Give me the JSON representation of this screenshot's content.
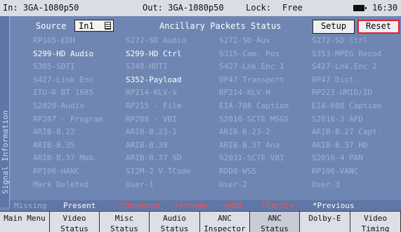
{
  "status_bar": {
    "input": "In: 3GA-1080p50",
    "output": "Out: 3GA-1080p50",
    "lock_label": "Lock:",
    "lock_value": "Free",
    "time": "16:30"
  },
  "side_tab": "Signal Information",
  "header": {
    "source_label": "Source",
    "source_value": "In1",
    "title": "Ancillary Packets Status",
    "setup_label": "Setup",
    "reset_label": "Reset"
  },
  "packets": [
    [
      {
        "t": "RP165-EDH",
        "hi": false
      },
      {
        "t": "S272-SD Audio",
        "hi": false
      },
      {
        "t": "S272-SD Aux",
        "hi": false
      },
      {
        "t": "S272-SD Ctrl",
        "hi": false
      }
    ],
    [
      {
        "t": "S299-HD Audio",
        "hi": true
      },
      {
        "t": "S299-HD Ctrl",
        "hi": true
      },
      {
        "t": "S315-Cam. Pos",
        "hi": false
      },
      {
        "t": "S353-MPEG Recod",
        "hi": false
      }
    ],
    [
      {
        "t": "S305-SDTI",
        "hi": false
      },
      {
        "t": "S348-HDTI",
        "hi": false
      },
      {
        "t": "S427-Lnk.Enc 1",
        "hi": false
      },
      {
        "t": "S427-Lnk.Enc 2",
        "hi": false
      }
    ],
    [
      {
        "t": "S427-Link Enc",
        "hi": false
      },
      {
        "t": "S352-Payload",
        "hi": true
      },
      {
        "t": "OP47 Transport",
        "hi": false
      },
      {
        "t": "OP47 Dist.",
        "hi": false
      }
    ],
    [
      {
        "t": "ITU-R BT 1685",
        "hi": false
      },
      {
        "t": "RP214-KLV-V",
        "hi": false
      },
      {
        "t": "RP214-KLV-H",
        "hi": false
      },
      {
        "t": "RP223-UMID/ID",
        "hi": false
      }
    ],
    [
      {
        "t": "S2020-Audio",
        "hi": false
      },
      {
        "t": "RP215 - Film",
        "hi": false
      },
      {
        "t": "EIA-708 Caption",
        "hi": false
      },
      {
        "t": "EIA-608 Caption",
        "hi": false
      }
    ],
    [
      {
        "t": "RP207 - Program",
        "hi": false
      },
      {
        "t": "RP208 - VBI",
        "hi": false
      },
      {
        "t": "S2010-SCTE MSGS",
        "hi": false
      },
      {
        "t": "S2016-3 AFD",
        "hi": false
      }
    ],
    [
      {
        "t": "ARIB-B.22",
        "hi": false
      },
      {
        "t": "ARIB-B.23-1",
        "hi": false
      },
      {
        "t": "ARIB-B.23-2",
        "hi": false
      },
      {
        "t": "ARIB-B.27 Capt.",
        "hi": false
      }
    ],
    [
      {
        "t": "ARIB-B.35",
        "hi": false
      },
      {
        "t": "ARIB-B.39",
        "hi": false
      },
      {
        "t": "ARIB-B.37 Ana",
        "hi": false
      },
      {
        "t": "ARIB-B.37 HD",
        "hi": false
      }
    ],
    [
      {
        "t": "ARIB-B.37 Mob.",
        "hi": false
      },
      {
        "t": "ARIB-B.37 SD",
        "hi": false
      },
      {
        "t": "S2031-SCTE VBI",
        "hi": false
      },
      {
        "t": "S2016-4 PAN",
        "hi": false
      }
    ],
    [
      {
        "t": "RP196-HANC",
        "hi": false
      },
      {
        "t": "S12M-2 V-TCode",
        "hi": false
      },
      {
        "t": "RDD8-WSS",
        "hi": false
      },
      {
        "t": "RP196-VANC",
        "hi": false
      }
    ],
    [
      {
        "t": "Mark Deleted",
        "hi": false
      },
      {
        "t": "User-1",
        "hi": false
      },
      {
        "t": "User-2",
        "hi": false
      },
      {
        "t": "User-3",
        "hi": false
      }
    ]
  ],
  "legend": [
    {
      "t": "Missing",
      "color": "#9fb1d6"
    },
    {
      "t": "Present",
      "color": "#ffffff"
    },
    {
      "t": "!Checksum",
      "color": "#ff4f4f"
    },
    {
      "t": ">Stream",
      "color": "#ff4f4f"
    },
    {
      "t": "+DBN",
      "color": "#ff4f4f"
    },
    {
      "t": "?Parity",
      "color": "#ff4f4f"
    },
    {
      "t": "*Previous",
      "color": "#ffffff"
    }
  ],
  "menu": [
    {
      "l1": "Main Menu",
      "l2": ""
    },
    {
      "l1": "Video",
      "l2": "Status"
    },
    {
      "l1": "Misc",
      "l2": "Status"
    },
    {
      "l1": "Audio",
      "l2": "Status"
    },
    {
      "l1": "ANC",
      "l2": "Inspector"
    },
    {
      "l1": "ANC",
      "l2": "Status"
    },
    {
      "l1": "Dolby-E",
      "l2": ""
    },
    {
      "l1": "Video",
      "l2": "Timing"
    }
  ],
  "icons": {
    "battery": "battery-icon",
    "list": "list-icon"
  }
}
